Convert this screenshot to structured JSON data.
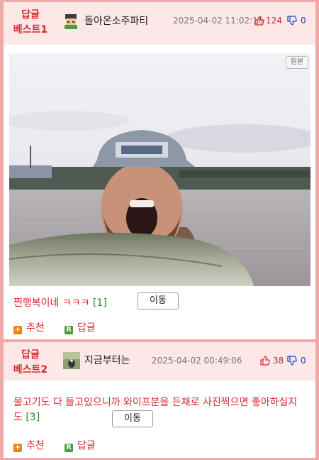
{
  "posts": [
    {
      "best_line1": "답글",
      "best_line2": "베스트1",
      "nick": "돌아온소주파티",
      "date": "2025-04-02 11:02:16",
      "up": "124",
      "down": "0",
      "orig_badge": "원본",
      "comment": "찐행복이네 ㅋㅋㅋ",
      "comment_count": "[1]",
      "move_label": "이동",
      "recommend_label": "추천",
      "reply_label": "답글"
    },
    {
      "best_line1": "답글",
      "best_line2": "베스트2",
      "nick": "지금부터는",
      "date": "2025-04-02 00:49:06",
      "up": "38",
      "down": "0",
      "comment": "물고기도 다 들고있으니까 와이프분을 든채로 사진찍으면 좋아하실지도",
      "comment_count": "[3]",
      "move_label": "이동",
      "recommend_label": "추천",
      "reply_label": "답글"
    }
  ],
  "icons": {
    "recommend_icon_char": "+",
    "reply_icon_char": "R"
  },
  "colors": {
    "accent_red": "#d9262c",
    "down_blue": "#1a40c0",
    "count_green": "#2a8a2a",
    "recommend_orange": "#e8841a",
    "reply_green": "#4a9a3a",
    "border_pink": "#f0a8a8"
  }
}
